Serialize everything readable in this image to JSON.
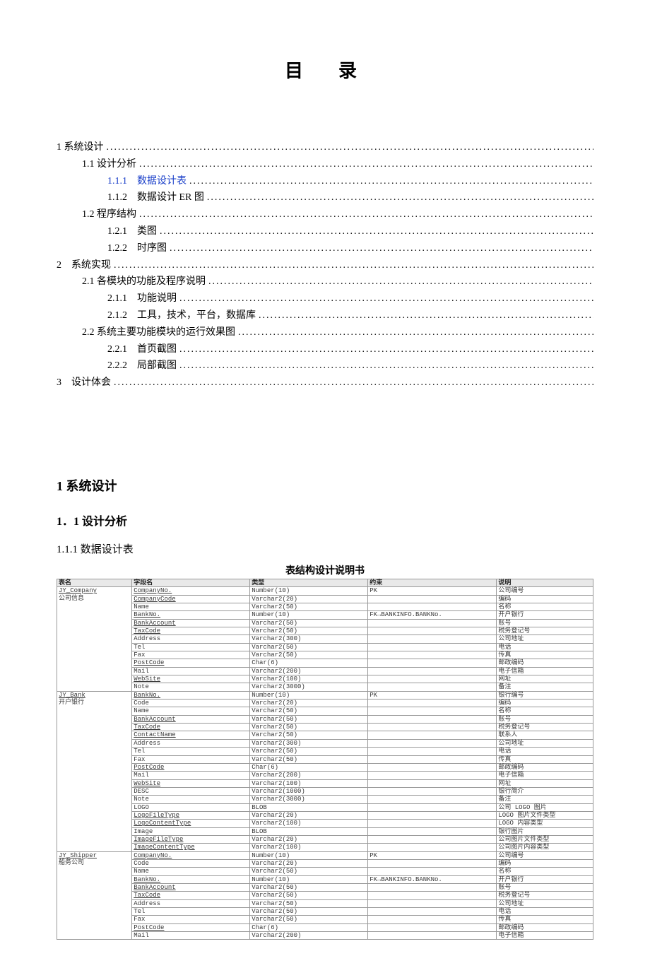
{
  "title": "目　录",
  "toc": [
    {
      "level": 1,
      "label": "1 系统设计"
    },
    {
      "level": 2,
      "label": "1.1 设计分析"
    },
    {
      "level": 3,
      "label": "1.1.1　数据设计表",
      "link": true
    },
    {
      "level": 3,
      "label": "1.1.2　数据设计 ER 图"
    },
    {
      "level": 2,
      "label": "1.2 程序结构"
    },
    {
      "level": 3,
      "label": "1.2.1　类图"
    },
    {
      "level": 3,
      "label": "1.2.2　时序图"
    },
    {
      "level": 1,
      "label": "2　系统实现"
    },
    {
      "level": 2,
      "label": "2.1 各模块的功能及程序说明"
    },
    {
      "level": 3,
      "label": "2.1.1　功能说明"
    },
    {
      "level": 3,
      "label": "2.1.2　工具，技术，平台，数据库"
    },
    {
      "level": 2,
      "label": "2.2 系统主要功能模块的运行效果图"
    },
    {
      "level": 3,
      "label": "2.2.1　首页截图"
    },
    {
      "level": 3,
      "label": "2.2.2　局部截图"
    },
    {
      "level": 1,
      "label": "3　设计体会"
    }
  ],
  "sections": {
    "s1": "1 系统设计",
    "s1_1": "1．1 设计分析",
    "s1_1_1": "1.1.1 数据设计表"
  },
  "tableCaption": "表结构设计说明书",
  "schemaHeaders": [
    "表名",
    "字段名",
    "类型",
    "约束",
    "说明"
  ],
  "schema": [
    {
      "tname": "JY_Company",
      "tdesc": "公司信息",
      "rows": [
        {
          "f": "CompanyNo.",
          "t": "Number(10)",
          "c": "PK",
          "d": "公司编号",
          "u": true
        },
        {
          "f": "CompanyCode",
          "t": "Varchar2(20)",
          "c": "",
          "d": "编码",
          "u": true
        },
        {
          "f": "Name",
          "t": "Varchar2(50)",
          "c": "",
          "d": "名称"
        },
        {
          "f": "BankNo.",
          "t": "Number(10)",
          "c": "FK→BANKINFO.BANKNo.",
          "d": "开户银行",
          "u": true
        },
        {
          "f": "BankAccount",
          "t": "Varchar2(50)",
          "c": "",
          "d": "账号",
          "u": true
        },
        {
          "f": "TaxCode",
          "t": "Varchar2(50)",
          "c": "",
          "d": "税务登记号",
          "u": true
        },
        {
          "f": "Address",
          "t": "Varchar2(300)",
          "c": "",
          "d": "公司地址"
        },
        {
          "f": "Tel",
          "t": "Varchar2(50)",
          "c": "",
          "d": "电话"
        },
        {
          "f": "Fax",
          "t": "Varchar2(50)",
          "c": "",
          "d": "传真"
        },
        {
          "f": "PostCode",
          "t": "Char(6)",
          "c": "",
          "d": "邮政编码",
          "u": true
        },
        {
          "f": "Mail",
          "t": "Varchar2(200)",
          "c": "",
          "d": "电子信箱"
        },
        {
          "f": "WebSite",
          "t": "Varchar2(100)",
          "c": "",
          "d": "网址",
          "u": true
        },
        {
          "f": "Note",
          "t": "Varchar2(3000)",
          "c": "",
          "d": "备注"
        }
      ]
    },
    {
      "tname": "JY_Bank",
      "tdesc": "开户银行",
      "rows": [
        {
          "f": "BankNo.",
          "t": "Number(10)",
          "c": "PK",
          "d": "银行编号",
          "u": true
        },
        {
          "f": "Code",
          "t": "Varchar2(20)",
          "c": "",
          "d": "编码"
        },
        {
          "f": "Name",
          "t": "Varchar2(50)",
          "c": "",
          "d": "名称"
        },
        {
          "f": "BankAccount",
          "t": "Varchar2(50)",
          "c": "",
          "d": "账号",
          "u": true
        },
        {
          "f": "TaxCode",
          "t": "Varchar2(50)",
          "c": "",
          "d": "税务登记号",
          "u": true
        },
        {
          "f": "ContactName",
          "t": "Varchar2(50)",
          "c": "",
          "d": "联系人",
          "u": true
        },
        {
          "f": "Address",
          "t": "Varchar2(300)",
          "c": "",
          "d": "公司地址"
        },
        {
          "f": "Tel",
          "t": "Varchar2(50)",
          "c": "",
          "d": "电话"
        },
        {
          "f": "Fax",
          "t": "Varchar2(50)",
          "c": "",
          "d": "传真"
        },
        {
          "f": "PostCode",
          "t": "Char(6)",
          "c": "",
          "d": "邮政编码",
          "u": true
        },
        {
          "f": "Mail",
          "t": "Varchar2(200)",
          "c": "",
          "d": "电子信箱"
        },
        {
          "f": "WebSite",
          "t": "Varchar2(100)",
          "c": "",
          "d": "网址",
          "u": true
        },
        {
          "f": "DESC",
          "t": "Varchar2(1000)",
          "c": "",
          "d": "银行简介"
        },
        {
          "f": "Note",
          "t": "Varchar2(3000)",
          "c": "",
          "d": "备注"
        },
        {
          "f": "LOGO",
          "t": "BLOB",
          "c": "",
          "d": "公司 LOGO 图片"
        },
        {
          "f": "LogoFileType",
          "t": "Varchar2(20)",
          "c": "",
          "d": "LOGO 图片文件类型",
          "u": true
        },
        {
          "f": "LogoContentType",
          "t": "Varchar2(100)",
          "c": "",
          "d": "LOGO 内容类型",
          "u": true
        },
        {
          "f": "Image",
          "t": "BLOB",
          "c": "",
          "d": "银行图片"
        },
        {
          "f": "ImageFileType",
          "t": "Varchar2(20)",
          "c": "",
          "d": "公司图片文件类型",
          "u": true
        },
        {
          "f": "ImageContentType",
          "t": "Varchar2(100)",
          "c": "",
          "d": "公司图片内容类型",
          "u": true
        }
      ]
    },
    {
      "tname": "JY_Shipper",
      "tdesc": "船务公司",
      "rows": [
        {
          "f": "CompanyNo.",
          "t": "Number(10)",
          "c": "PK",
          "d": "公司编号",
          "u": true
        },
        {
          "f": "Code",
          "t": "Varchar2(20)",
          "c": "",
          "d": "编码"
        },
        {
          "f": "Name",
          "t": "Varchar2(50)",
          "c": "",
          "d": "名称"
        },
        {
          "f": "BankNo.",
          "t": "Number(10)",
          "c": "FK→BANKINFO.BANKNo.",
          "d": "开户银行",
          "u": true
        },
        {
          "f": "BankAccount",
          "t": "Varchar2(50)",
          "c": "",
          "d": "账号",
          "u": true
        },
        {
          "f": "TaxCode",
          "t": "Varchar2(50)",
          "c": "",
          "d": "税务登记号",
          "u": true
        },
        {
          "f": "Address",
          "t": "Varchar2(50)",
          "c": "",
          "d": "公司地址"
        },
        {
          "f": "Tel",
          "t": "Varchar2(50)",
          "c": "",
          "d": "电话"
        },
        {
          "f": "Fax",
          "t": "Varchar2(50)",
          "c": "",
          "d": "传真"
        },
        {
          "f": "PostCode",
          "t": "Char(6)",
          "c": "",
          "d": "邮政编码",
          "u": true
        },
        {
          "f": "Mail",
          "t": "Varchar2(200)",
          "c": "",
          "d": "电子信箱"
        }
      ]
    }
  ]
}
